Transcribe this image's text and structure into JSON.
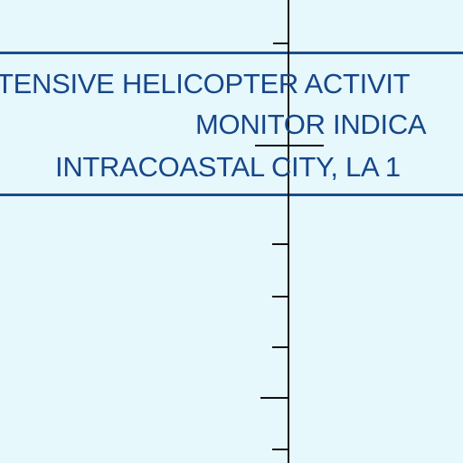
{
  "notice_box": {
    "line1": "TENSIVE HELICOPTER ACTIVIT",
    "line2": "MONITOR INDICA",
    "line3": "INTRACOASTAL CITY, LA 1"
  },
  "colors": {
    "background": "#e6f8fc",
    "text": "#17478a",
    "grid_line": "#111111"
  }
}
